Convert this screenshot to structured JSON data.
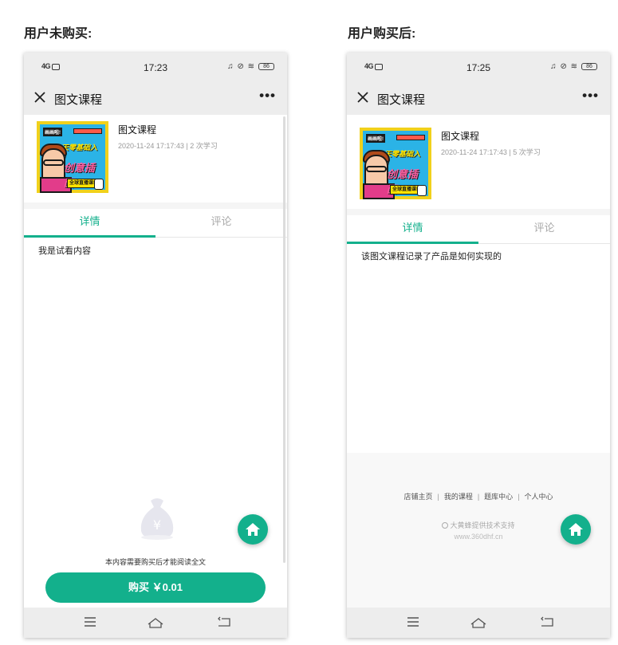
{
  "headings": {
    "left": "用户未购买:",
    "right": "用户购买后:"
  },
  "status_bar": {
    "left_signal": "4G",
    "left_hd": "HD",
    "left_time": "17:23",
    "right_time": "17:25",
    "icons": "♫ ⊘ ≋",
    "battery": "86"
  },
  "nav": {
    "title": "图文课程",
    "more": "•••"
  },
  "course": {
    "title": "图文课程",
    "cover_texts": [
      "画画啦!",
      "7天零基础入门",
      "创意插画",
      "全球直播课!"
    ],
    "left_meta": "2020-11-24 17:17:43 | 2 次学习",
    "right_meta": "2020-11-24 17:17:43 | 5 次学习"
  },
  "tabs": {
    "detail": "详情",
    "comment": "评论"
  },
  "left_screen": {
    "trial_text": "我是试看内容",
    "locked_notice": "本内容需要购买后才能阅读全文",
    "buy_button": "购买 ￥0.01"
  },
  "right_screen": {
    "content_text": "该图文课程记录了产品是如何实现的",
    "footer_links": [
      "店铺主页",
      "我的课程",
      "题库中心",
      "个人中心"
    ],
    "support_text": "大黄蜂提供技术支持",
    "support_url": "www.360dhf.cn"
  },
  "colors": {
    "accent": "#13b08c",
    "bar_bg": "#ededed"
  },
  "icons": {
    "close": "close-icon",
    "more": "more-icon",
    "home": "home-icon",
    "menu": "menu-icon",
    "back_home": "house-outline-icon",
    "return": "return-icon",
    "money_bag": "money-bag-icon"
  }
}
